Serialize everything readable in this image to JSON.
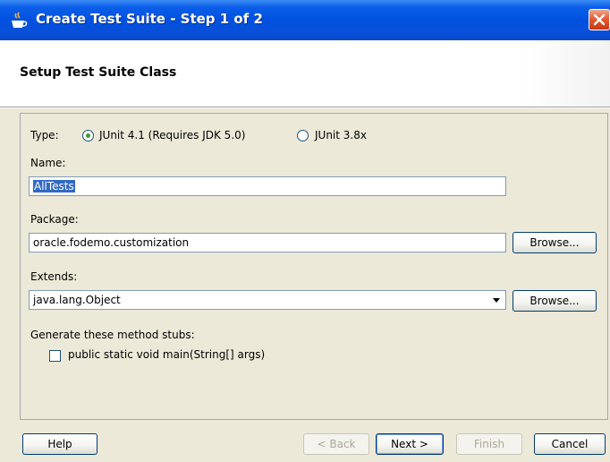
{
  "window": {
    "title": "Create Test Suite - Step 1 of 2"
  },
  "header": {
    "title": "Setup Test Suite Class"
  },
  "form": {
    "type_label": "Type:",
    "type_options": [
      {
        "label": "JUnit 4.1 (Requires JDK 5.0)",
        "checked": true
      },
      {
        "label": "JUnit 3.8x",
        "checked": false
      }
    ],
    "name_label": "Name:",
    "name_value": "AllTests",
    "package_label": "Package:",
    "package_value": "oracle.fodemo.customization",
    "package_browse": "Browse...",
    "extends_label": "Extends:",
    "extends_value": "java.lang.Object",
    "extends_browse": "Browse...",
    "stubs_label": "Generate these method stubs:",
    "stub_main_label": "public static void main(String[] args)",
    "stub_main_checked": false
  },
  "buttons": {
    "help": "Help",
    "back": "< Back",
    "next": "Next >",
    "finish": "Finish",
    "cancel": "Cancel"
  },
  "icons": {
    "app": "java-cup-icon",
    "close": "close-icon",
    "dropdown": "chevron-down-icon"
  }
}
